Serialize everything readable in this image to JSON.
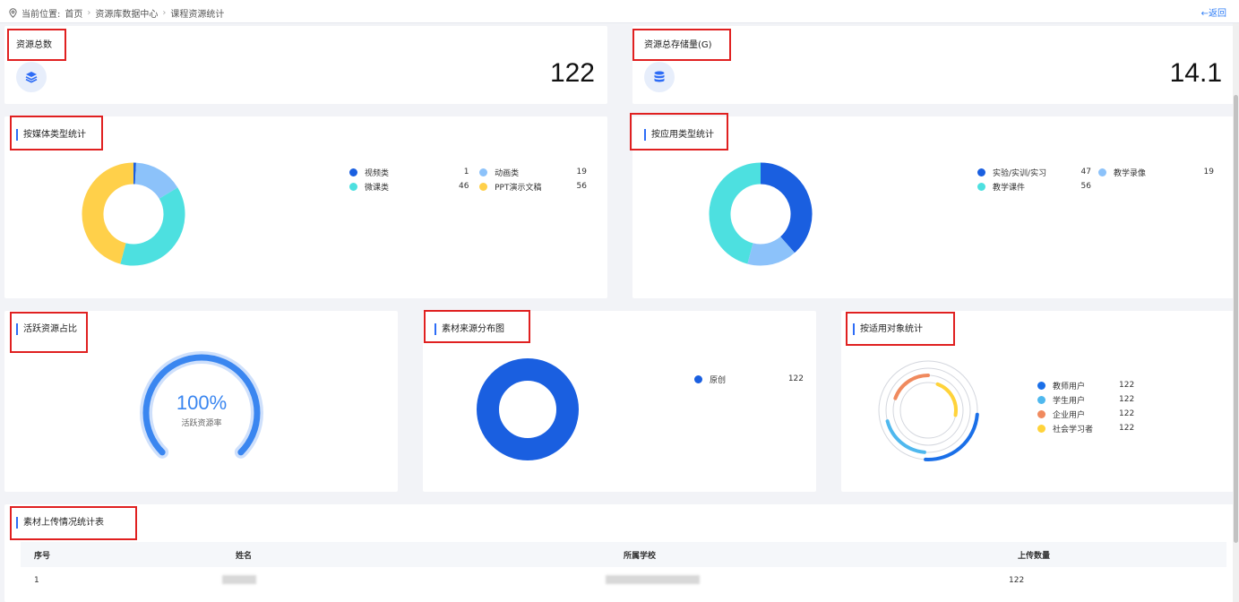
{
  "breadcrumb": {
    "prefix": "当前位置:",
    "items": [
      "首页",
      "资源库数据中心",
      "课程资源统计"
    ],
    "back": "←返回"
  },
  "summary": {
    "total": {
      "label": "资源总数",
      "value": "122"
    },
    "storage": {
      "label": "资源总存储量(G)",
      "value": "14.1"
    }
  },
  "media": {
    "title": "按媒体类型统计",
    "legend": [
      {
        "name": "视频类",
        "value": "1",
        "color": "#1a5fe0"
      },
      {
        "name": "动画类",
        "value": "19",
        "color": "#8cc2fa"
      },
      {
        "name": "微课类",
        "value": "46",
        "color": "#4de0e0"
      },
      {
        "name": "PPT演示文稿",
        "value": "56",
        "color": "#ffd04a"
      }
    ]
  },
  "application": {
    "title": "按应用类型统计",
    "legend": [
      {
        "name": "实验/实训/实习",
        "value": "47",
        "color": "#1a5fe0"
      },
      {
        "name": "教学录像",
        "value": "19",
        "color": "#8cc2fa"
      },
      {
        "name": "教学课件",
        "value": "56",
        "color": "#4de0e0"
      }
    ]
  },
  "active": {
    "title": "活跃资源占比",
    "percent": "100%",
    "label": "活跃资源率",
    "fraction": 1.0
  },
  "source": {
    "title": "素材来源分布图",
    "legend": [
      {
        "name": "原创",
        "value": "122",
        "color": "#1a5fe0"
      }
    ]
  },
  "audience": {
    "title": "按适用对象统计",
    "legend": [
      {
        "name": "教师用户",
        "value": "122",
        "color": "#1a6fe8"
      },
      {
        "name": "学生用户",
        "value": "122",
        "color": "#4fb8ee"
      },
      {
        "name": "企业用户",
        "value": "122",
        "color": "#f08a5e"
      },
      {
        "name": "社会学习者",
        "value": "122",
        "color": "#ffd33a"
      }
    ]
  },
  "upload_table": {
    "title": "素材上传情况统计表",
    "columns": [
      "序号",
      "姓名",
      "所属学校",
      "上传数量"
    ],
    "rows": [
      {
        "index": "1",
        "count": "122"
      }
    ]
  }
}
